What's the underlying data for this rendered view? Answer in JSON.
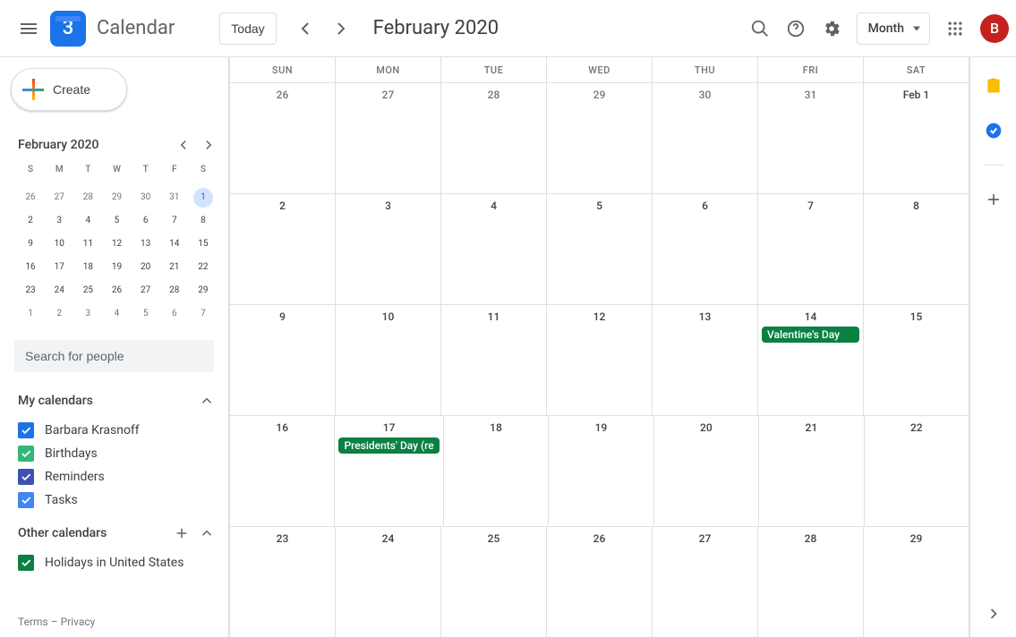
{
  "header": {
    "logo_day": "3",
    "app_name": "Calendar",
    "today_label": "Today",
    "title": "February 2020",
    "view_label": "Month",
    "avatar_letter": "B"
  },
  "sidebar": {
    "create_label": "Create",
    "mini_title": "February 2020",
    "dow": [
      "S",
      "M",
      "T",
      "W",
      "T",
      "F",
      "S"
    ],
    "mini_weeks": [
      [
        {
          "n": "26",
          "other": true
        },
        {
          "n": "27",
          "other": true
        },
        {
          "n": "28",
          "other": true
        },
        {
          "n": "29",
          "other": true
        },
        {
          "n": "30",
          "other": true
        },
        {
          "n": "31",
          "other": true
        },
        {
          "n": "1",
          "sel": true
        }
      ],
      [
        {
          "n": "2"
        },
        {
          "n": "3"
        },
        {
          "n": "4"
        },
        {
          "n": "5"
        },
        {
          "n": "6"
        },
        {
          "n": "7"
        },
        {
          "n": "8"
        }
      ],
      [
        {
          "n": "9"
        },
        {
          "n": "10"
        },
        {
          "n": "11"
        },
        {
          "n": "12"
        },
        {
          "n": "13"
        },
        {
          "n": "14"
        },
        {
          "n": "15"
        }
      ],
      [
        {
          "n": "16"
        },
        {
          "n": "17"
        },
        {
          "n": "18"
        },
        {
          "n": "19"
        },
        {
          "n": "20"
        },
        {
          "n": "21"
        },
        {
          "n": "22"
        }
      ],
      [
        {
          "n": "23"
        },
        {
          "n": "24"
        },
        {
          "n": "25"
        },
        {
          "n": "26"
        },
        {
          "n": "27"
        },
        {
          "n": "28"
        },
        {
          "n": "29"
        }
      ],
      [
        {
          "n": "1",
          "other": true
        },
        {
          "n": "2",
          "other": true
        },
        {
          "n": "3",
          "other": true
        },
        {
          "n": "4",
          "other": true
        },
        {
          "n": "5",
          "other": true
        },
        {
          "n": "6",
          "other": true
        },
        {
          "n": "7",
          "other": true
        }
      ]
    ],
    "search_placeholder": "Search for people",
    "my_calendars_label": "My calendars",
    "my_calendars": [
      {
        "label": "Barbara Krasnoff",
        "color": "#1a73e8"
      },
      {
        "label": "Birthdays",
        "color": "#33b679"
      },
      {
        "label": "Reminders",
        "color": "#3f51b5"
      },
      {
        "label": "Tasks",
        "color": "#4285f4"
      }
    ],
    "other_calendars_label": "Other calendars",
    "other_calendars": [
      {
        "label": "Holidays in United States",
        "color": "#0b8043"
      }
    ],
    "terms_label": "Terms",
    "privacy_label": "Privacy"
  },
  "grid": {
    "dow": [
      "SUN",
      "MON",
      "TUE",
      "WED",
      "THU",
      "FRI",
      "SAT"
    ],
    "weeks": [
      [
        {
          "n": "26",
          "other": true
        },
        {
          "n": "27",
          "other": true
        },
        {
          "n": "28",
          "other": true
        },
        {
          "n": "29",
          "other": true
        },
        {
          "n": "30",
          "other": true
        },
        {
          "n": "31",
          "other": true
        },
        {
          "n": "Feb 1"
        }
      ],
      [
        {
          "n": "2"
        },
        {
          "n": "3"
        },
        {
          "n": "4"
        },
        {
          "n": "5"
        },
        {
          "n": "6"
        },
        {
          "n": "7"
        },
        {
          "n": "8"
        }
      ],
      [
        {
          "n": "9"
        },
        {
          "n": "10"
        },
        {
          "n": "11"
        },
        {
          "n": "12"
        },
        {
          "n": "13"
        },
        {
          "n": "14",
          "events": [
            {
              "title": "Valentine's Day"
            }
          ]
        },
        {
          "n": "15"
        }
      ],
      [
        {
          "n": "16"
        },
        {
          "n": "17",
          "events": [
            {
              "title": "Presidents' Day (re"
            }
          ]
        },
        {
          "n": "18"
        },
        {
          "n": "19"
        },
        {
          "n": "20"
        },
        {
          "n": "21"
        },
        {
          "n": "22"
        }
      ],
      [
        {
          "n": "23"
        },
        {
          "n": "24"
        },
        {
          "n": "25"
        },
        {
          "n": "26"
        },
        {
          "n": "27"
        },
        {
          "n": "28"
        },
        {
          "n": "29"
        }
      ]
    ]
  }
}
